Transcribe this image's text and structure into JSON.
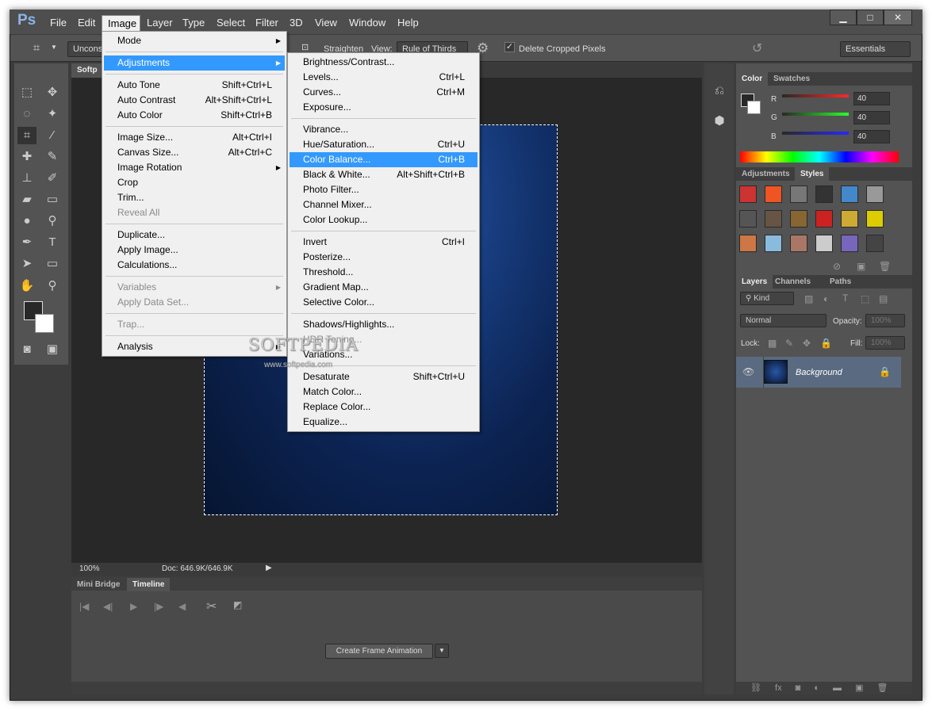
{
  "app": {
    "logo": "Ps"
  },
  "menubar": {
    "items": [
      "File",
      "Edit",
      "Image",
      "Layer",
      "Type",
      "Select",
      "Filter",
      "3D",
      "View",
      "Window",
      "Help"
    ],
    "window_controls": [
      "minimize",
      "maximize",
      "close"
    ]
  },
  "options": {
    "ratio": "Unconst",
    "straighten": "Straighten",
    "view_label": "View:",
    "view_value": "Rule of Thirds",
    "delete_cropped": "Delete Cropped Pixels",
    "delete_checked": true,
    "workspace": "Essentials"
  },
  "document": {
    "tab": "Softp",
    "zoom": "100%",
    "doc_info": "Doc: 646.9K/646.9K",
    "watermark": "SOFTPEDIA",
    "watermark_url": "www.softpedia.com"
  },
  "image_menu": [
    {
      "label": "Mode",
      "submenu": true
    },
    {
      "sep": true
    },
    {
      "label": "Adjustments",
      "submenu": true,
      "highlight": true
    },
    {
      "sep": true
    },
    {
      "label": "Auto Tone",
      "shortcut": "Shift+Ctrl+L"
    },
    {
      "label": "Auto Contrast",
      "shortcut": "Alt+Shift+Ctrl+L"
    },
    {
      "label": "Auto Color",
      "shortcut": "Shift+Ctrl+B"
    },
    {
      "sep": true
    },
    {
      "label": "Image Size...",
      "shortcut": "Alt+Ctrl+I"
    },
    {
      "label": "Canvas Size...",
      "shortcut": "Alt+Ctrl+C"
    },
    {
      "label": "Image Rotation",
      "submenu": true
    },
    {
      "label": "Crop"
    },
    {
      "label": "Trim..."
    },
    {
      "label": "Reveal All",
      "disabled": true
    },
    {
      "sep": true
    },
    {
      "label": "Duplicate..."
    },
    {
      "label": "Apply Image..."
    },
    {
      "label": "Calculations..."
    },
    {
      "sep": true
    },
    {
      "label": "Variables",
      "submenu": true,
      "disabled": true
    },
    {
      "label": "Apply Data Set...",
      "disabled": true
    },
    {
      "sep": true
    },
    {
      "label": "Trap...",
      "disabled": true
    },
    {
      "sep": true
    },
    {
      "label": "Analysis",
      "submenu": true
    }
  ],
  "adjustments_menu": [
    {
      "label": "Brightness/Contrast..."
    },
    {
      "label": "Levels...",
      "shortcut": "Ctrl+L"
    },
    {
      "label": "Curves...",
      "shortcut": "Ctrl+M"
    },
    {
      "label": "Exposure..."
    },
    {
      "sep": true
    },
    {
      "label": "Vibrance..."
    },
    {
      "label": "Hue/Saturation...",
      "shortcut": "Ctrl+U"
    },
    {
      "label": "Color Balance...",
      "shortcut": "Ctrl+B",
      "highlight": true
    },
    {
      "label": "Black & White...",
      "shortcut": "Alt+Shift+Ctrl+B"
    },
    {
      "label": "Photo Filter..."
    },
    {
      "label": "Channel Mixer..."
    },
    {
      "label": "Color Lookup..."
    },
    {
      "sep": true
    },
    {
      "label": "Invert",
      "shortcut": "Ctrl+I"
    },
    {
      "label": "Posterize..."
    },
    {
      "label": "Threshold..."
    },
    {
      "label": "Gradient Map..."
    },
    {
      "label": "Selective Color..."
    },
    {
      "sep": true
    },
    {
      "label": "Shadows/Highlights..."
    },
    {
      "label": "HDR Toning...",
      "disabled": true
    },
    {
      "label": "Variations..."
    },
    {
      "sep": true
    },
    {
      "label": "Desaturate",
      "shortcut": "Shift+Ctrl+U"
    },
    {
      "label": "Match Color..."
    },
    {
      "label": "Replace Color..."
    },
    {
      "label": "Equalize..."
    }
  ],
  "color_panel": {
    "tabs": [
      "Color",
      "Swatches"
    ],
    "channels": [
      {
        "name": "R",
        "value": "40"
      },
      {
        "name": "G",
        "value": "40"
      },
      {
        "name": "B",
        "value": "40"
      }
    ]
  },
  "styles_panel": {
    "tabs": [
      "Adjustments",
      "Styles"
    ]
  },
  "layers_panel": {
    "tabs": [
      "Layers",
      "Channels",
      "Paths"
    ],
    "filter": "Kind",
    "blend_mode": "Normal",
    "opacity_label": "Opacity:",
    "opacity": "100%",
    "lock_label": "Lock:",
    "fill_label": "Fill:",
    "fill": "100%",
    "layers": [
      {
        "name": "Background",
        "visible": true,
        "locked": true
      }
    ]
  },
  "timeline": {
    "tabs": [
      "Mini Bridge",
      "Timeline"
    ],
    "create_button": "Create Frame Animation"
  }
}
